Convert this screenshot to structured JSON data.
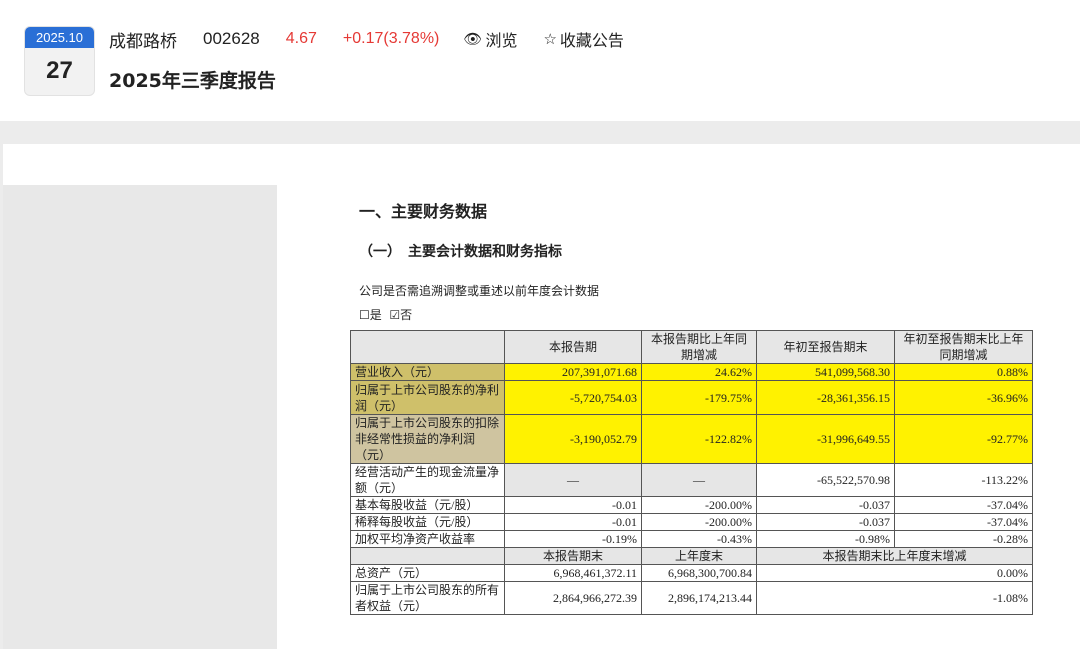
{
  "header": {
    "date_month": "2025.10",
    "date_day": "27",
    "stock_name": "成都路桥",
    "stock_code": "002628",
    "price": "4.67",
    "change": "+0.17(3.78%)",
    "browse_label": "浏览",
    "browse_icon": "eye-icon",
    "favorite_label": "收藏公告",
    "favorite_icon": "star-icon",
    "report_title": "2025年三季度报告"
  },
  "doc": {
    "section_title": "一、主要财务数据",
    "subsection_title": "（一）　主要会计数据和财务指标",
    "question": "公司是否需追溯调整或重述以前年度会计数据",
    "checkbox_yes": "☐是",
    "checkbox_no": "☑否"
  },
  "colors": {
    "accent": "#2a6fd6",
    "up": "#e53935",
    "highlight": "#fff200",
    "highlight_label": "#cfc06a"
  },
  "table": {
    "headers": [
      "",
      "本报告期",
      "本报告期比上年同期增减",
      "年初至报告期末",
      "年初至报告期末比上年同期增减"
    ],
    "rows": [
      {
        "label": "营业收入（元）",
        "values": [
          "207,391,071.68",
          "24.62%",
          "541,099,568.30",
          "0.88%"
        ]
      },
      {
        "label": "归属于上市公司股东的净利润（元）",
        "values": [
          "-5,720,754.03",
          "-179.75%",
          "-28,361,356.15",
          "-36.96%"
        ]
      },
      {
        "label": "归属于上市公司股东的扣除非经常性损益的净利润（元）",
        "values": [
          "-3,190,052.79",
          "-122.82%",
          "-31,996,649.55",
          "-92.77%"
        ]
      },
      {
        "label": "经营活动产生的现金流量净额（元）",
        "values": [
          "—",
          "—",
          "-65,522,570.98",
          "-113.22%"
        ]
      },
      {
        "label": "基本每股收益（元/股）",
        "values": [
          "-0.01",
          "-200.00%",
          "-0.037",
          "-37.04%"
        ]
      },
      {
        "label": "稀释每股收益（元/股）",
        "values": [
          "-0.01",
          "-200.00%",
          "-0.037",
          "-37.04%"
        ]
      },
      {
        "label": "加权平均净资产收益率",
        "values": [
          "-0.19%",
          "-0.43%",
          "-0.98%",
          "-0.28%"
        ]
      }
    ],
    "headers2": [
      "",
      "本报告期末",
      "上年度末",
      "本报告期末比上年度末增减"
    ],
    "rows2": [
      {
        "label": "总资产（元）",
        "values": [
          "6,968,461,372.11",
          "6,968,300,700.84",
          "0.00%"
        ]
      },
      {
        "label": "归属于上市公司股东的所有者权益（元）",
        "values": [
          "2,864,966,272.39",
          "2,896,174,213.44",
          "-1.08%"
        ]
      }
    ]
  }
}
